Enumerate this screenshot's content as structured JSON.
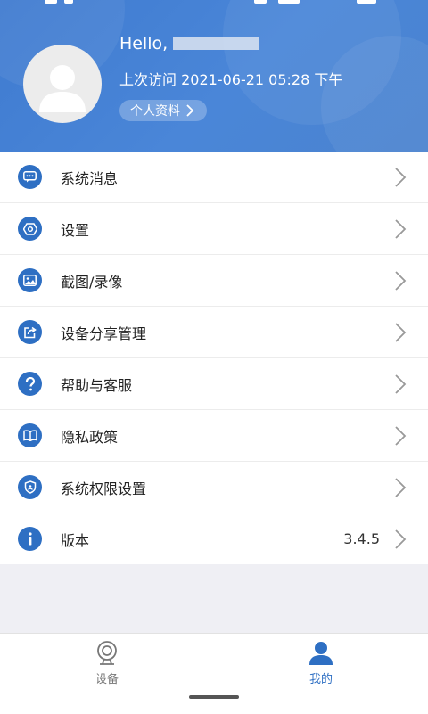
{
  "header": {
    "hello": "Hello,",
    "last_visit": "上次访问 2021-06-21 05:28 下午",
    "profile_button": "个人资料"
  },
  "menu": [
    {
      "label": "系统消息",
      "icon": "message-icon",
      "value": ""
    },
    {
      "label": "设置",
      "icon": "settings-icon",
      "value": ""
    },
    {
      "label": "截图/录像",
      "icon": "image-icon",
      "value": ""
    },
    {
      "label": "设备分享管理",
      "icon": "share-icon",
      "value": ""
    },
    {
      "label": "帮助与客服",
      "icon": "help-icon",
      "value": ""
    },
    {
      "label": "隐私政策",
      "icon": "book-icon",
      "value": ""
    },
    {
      "label": "系统权限设置",
      "icon": "shield-icon",
      "value": ""
    },
    {
      "label": "版本",
      "icon": "info-icon",
      "value": "3.4.5"
    }
  ],
  "tabs": {
    "devices": {
      "label": "设备",
      "icon": "camera-icon",
      "active": false
    },
    "mine": {
      "label": "我的",
      "icon": "person-icon",
      "active": true
    }
  },
  "colors": {
    "header": "#4a86d8",
    "accent": "#2e6fc3",
    "inactive_tab": "#777777"
  }
}
